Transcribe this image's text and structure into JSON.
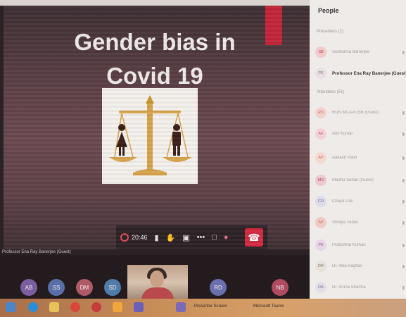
{
  "slide": {
    "title": "Gender bias in\nCovid 19",
    "image_icon": "gender-balance-scale-icon"
  },
  "toolbar": {
    "timer": "20:46",
    "icons": [
      "record-icon",
      "chat-icon",
      "raise-hand-icon",
      "share-icon",
      "more-icon",
      "device-icon",
      "participants-icon",
      "end-call-icon"
    ]
  },
  "presenter_label": "Professor Ena Ray Banerjee (Guest)",
  "bottom_avatars": [
    {
      "initials": "AB",
      "color": "#7a5ea0"
    },
    {
      "initials": "SS",
      "color": "#5a6fa8"
    },
    {
      "initials": "DM",
      "color": "#b05a68"
    },
    {
      "initials": "SD",
      "color": "#4f7ca8"
    },
    {
      "initials": "RD",
      "color": "#6a6fae"
    },
    {
      "initials": "NB",
      "color": "#b04a60"
    }
  ],
  "people": {
    "title": "People",
    "sections": [
      {
        "label": "Presenters (2)"
      },
      {
        "label": "Attendees (51)"
      }
    ],
    "items": [
      {
        "initials": "SB",
        "name": "Sudeshna Banerjee",
        "color": "#f3c9cc",
        "text_color": "#b04a55",
        "dark": false
      },
      {
        "initials": "PE",
        "name": "Professor Ena Ray Banerjee (Guest)",
        "color": "#e8dfe4",
        "text_color": "#8a6b75",
        "dark": true
      },
      {
        "initials": "RD",
        "name": "RDN MCAPOSB (Guest)",
        "color": "#f2d3cf",
        "text_color": "#c0685e",
        "dark": false
      },
      {
        "initials": "AK",
        "name": "Anil Kumar",
        "color": "#f3d2d6",
        "text_color": "#b8606c",
        "dark": false
      },
      {
        "initials": "AP",
        "name": "Aakash Patel",
        "color": "#f3d9cf",
        "text_color": "#c07460",
        "dark": false
      },
      {
        "initials": "MS",
        "name": "Madhu Sudan (Guest)",
        "color": "#ecc8cf",
        "text_color": "#b0485c",
        "dark": false
      },
      {
        "initials": "CD",
        "name": "Chaya Das",
        "color": "#dcdcea",
        "text_color": "#6a6a9a",
        "dark": false
      },
      {
        "initials": "SY",
        "name": "Shreya Yadav",
        "color": "#f0cbc6",
        "text_color": "#c0504a",
        "dark": false
      },
      {
        "initials": "PK",
        "name": "Pratishtha Kumari",
        "color": "#e6d6e8",
        "text_color": "#8a5a92",
        "dark": false
      },
      {
        "initials": "DR",
        "name": "Dr. Alka Raghav",
        "color": "#e6e2da",
        "text_color": "#8a7a60",
        "dark": false
      },
      {
        "initials": "DA",
        "name": "Dr. Aruna Sharma",
        "color": "#e3dfe8",
        "text_color": "#7a6d8f",
        "dark": false
      }
    ]
  },
  "taskbar": {
    "icons": [
      "start-icon",
      "search-icon",
      "task-view-icon",
      "file-explorer-icon",
      "chrome-icon",
      "browser-icon",
      "teams-icon",
      "app-icon"
    ],
    "items": [
      "Presenter Screen",
      "Microsoft Teams"
    ]
  }
}
